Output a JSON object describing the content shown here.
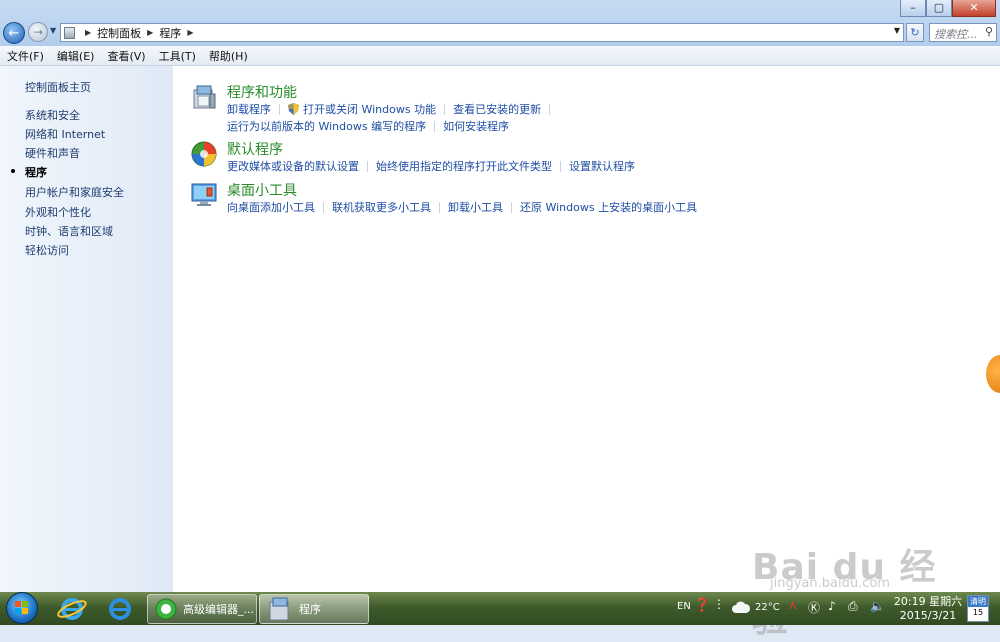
{
  "window": {
    "controls": {
      "minimize": "–",
      "maximize": "▢",
      "close": "✕"
    }
  },
  "address_bar": {
    "breadcrumb": [
      "控制面板",
      "程序"
    ],
    "search_placeholder": "搜索控..."
  },
  "menu": [
    "文件(F)",
    "编辑(E)",
    "查看(V)",
    "工具(T)",
    "帮助(H)"
  ],
  "sidebar": {
    "items": [
      {
        "label": "控制面板主页"
      },
      {
        "label": "系统和安全"
      },
      {
        "label": "网络和 Internet"
      },
      {
        "label": "硬件和声音"
      },
      {
        "label": "程序",
        "active": true
      },
      {
        "label": "用户帐户和家庭安全"
      },
      {
        "label": "外观和个性化"
      },
      {
        "label": "时钟、语言和区域"
      },
      {
        "label": "轻松访问"
      }
    ]
  },
  "categories": [
    {
      "title": "程序和功能",
      "icon": "programs-features-icon",
      "links": [
        "卸载程序",
        "打开或关闭 Windows 功能",
        "查看已安装的更新"
      ],
      "links2": [
        "运行为以前版本的 Windows 编写的程序",
        "如何安装程序"
      ]
    },
    {
      "title": "默认程序",
      "icon": "default-programs-icon",
      "links": [
        "更改媒体或设备的默认设置",
        "始终使用指定的程序打开此文件类型",
        "设置默认程序"
      ]
    },
    {
      "title": "桌面小工具",
      "icon": "desktop-gadgets-icon",
      "links": [
        "向桌面添加小工具",
        "联机获取更多小工具",
        "卸载小工具",
        "还原 Windows 上安装的桌面小工具"
      ]
    }
  ],
  "watermark": {
    "logo": "Bai du 经验",
    "url": "jingyan.baidu.com"
  },
  "taskbar": {
    "buttons": [
      {
        "label": "高级编辑器_..."
      },
      {
        "label": "程序"
      }
    ],
    "tray": {
      "lang": "EN",
      "temperature": "22°C",
      "time": "20:19 星期六",
      "date": "2015/3/21",
      "weather": "清明",
      "day": "15"
    }
  }
}
